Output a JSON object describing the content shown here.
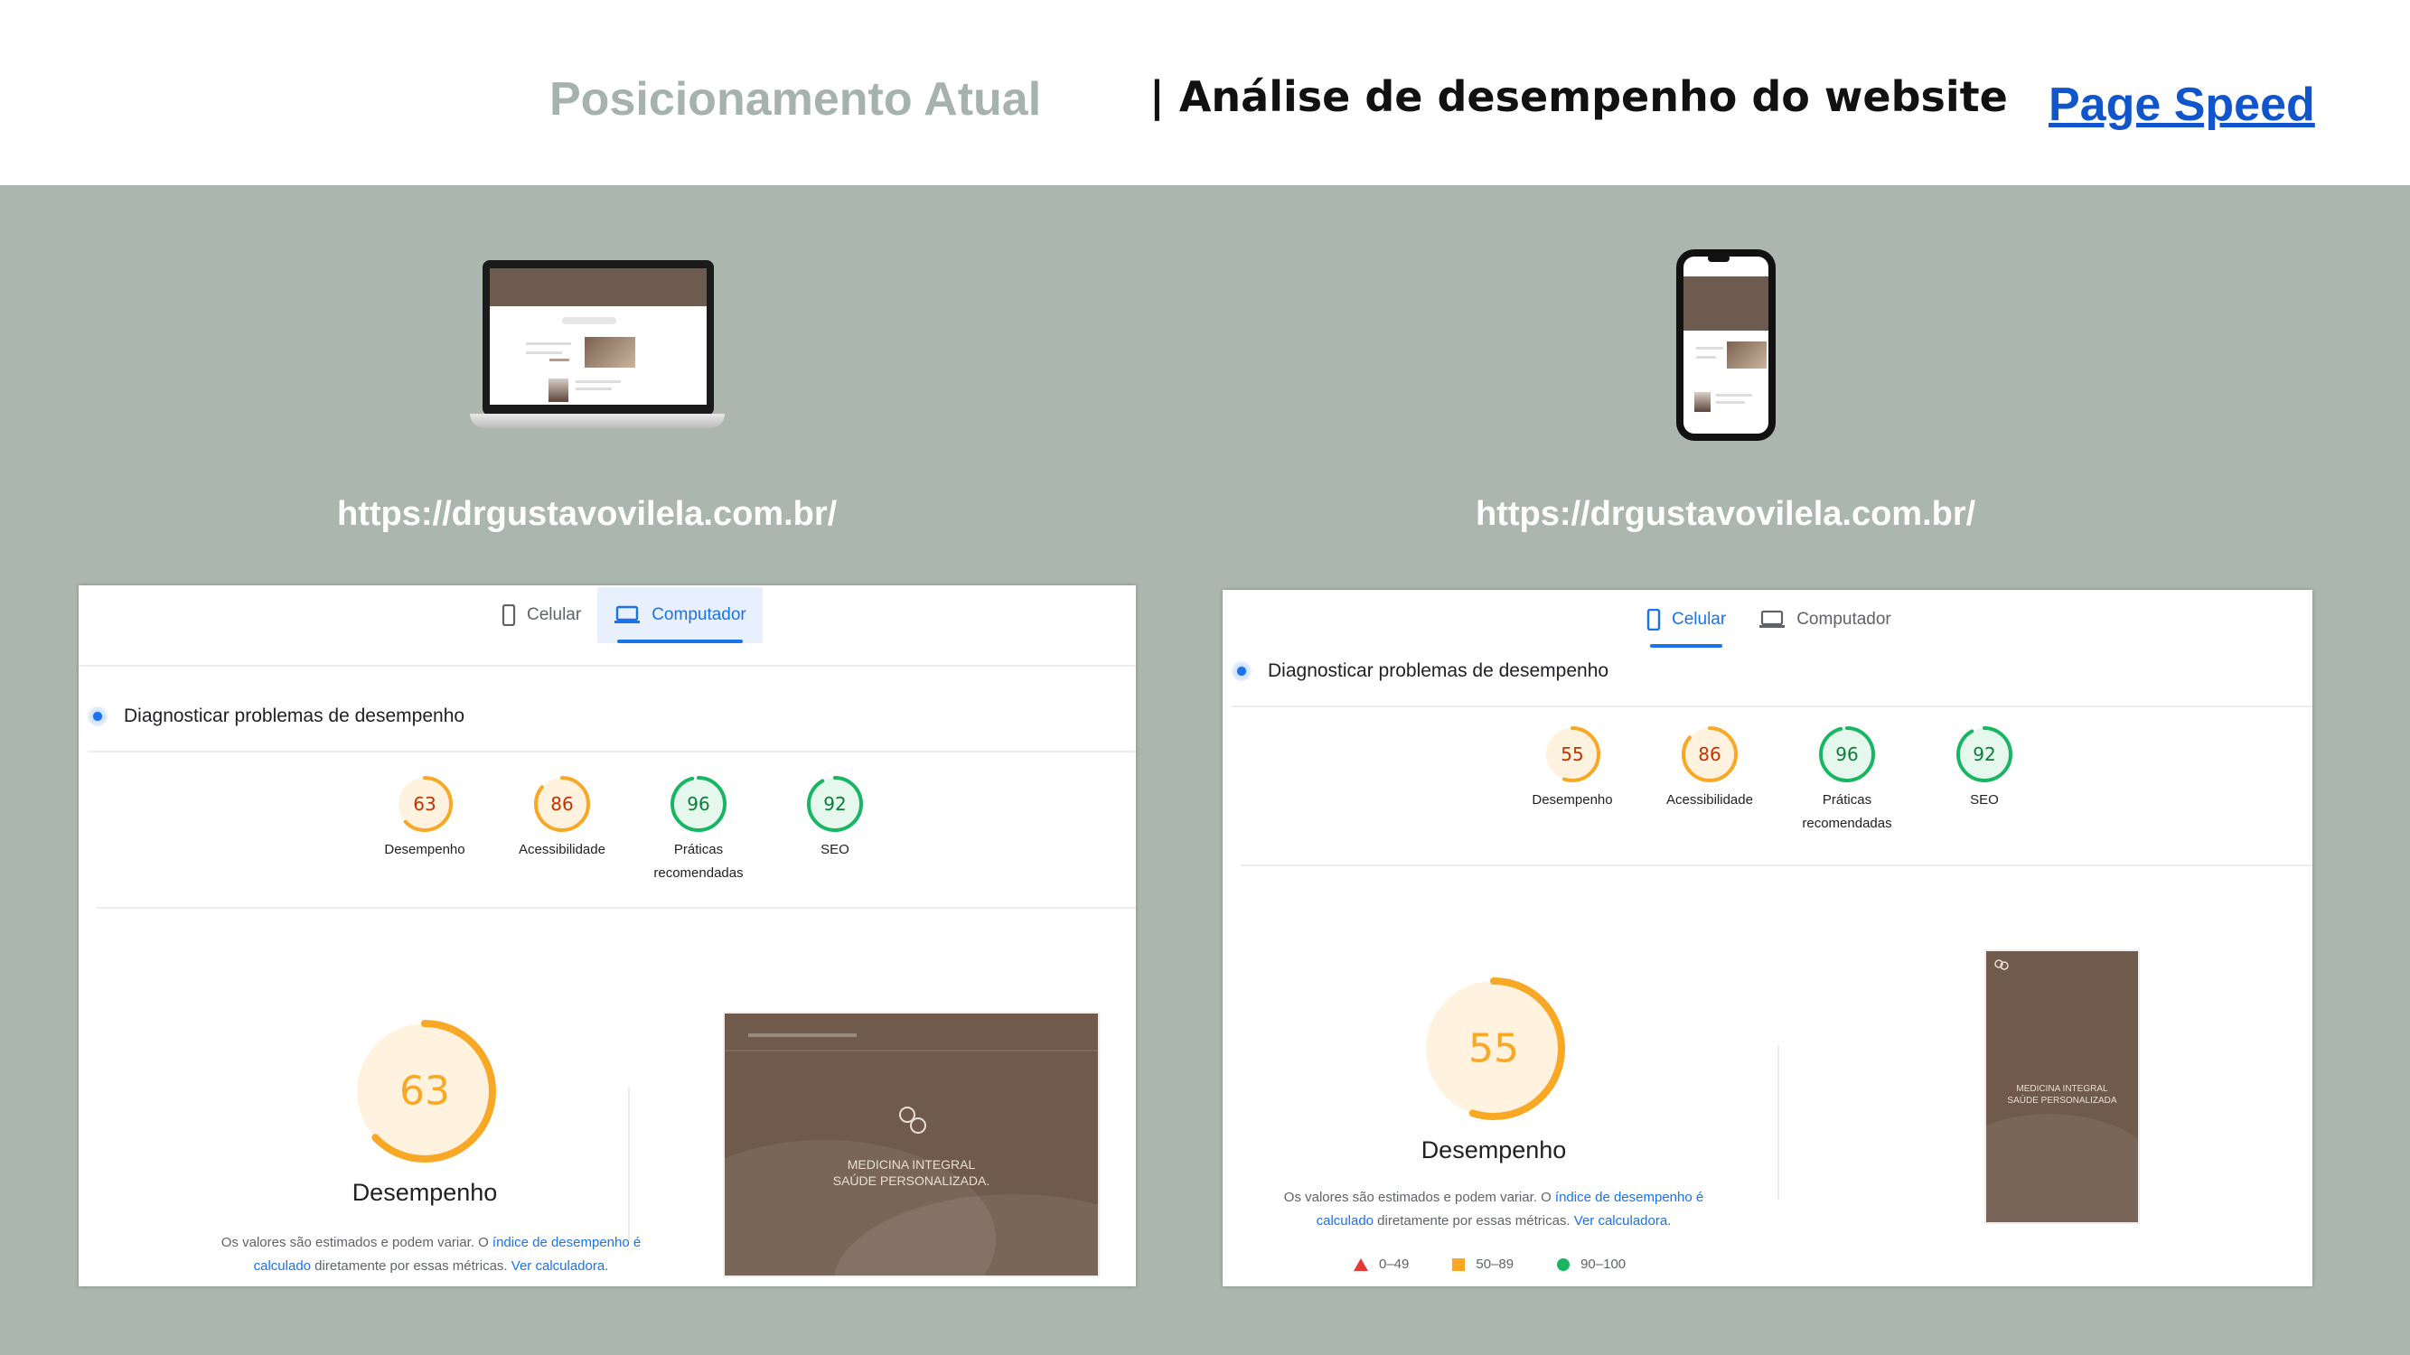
{
  "header": {
    "title_left": "Posicionamento Atual",
    "title_mid": "| Análise de desempenho do website",
    "link": "Page Speed"
  },
  "left": {
    "device": "laptop-mockup",
    "url": "https://drgustavovilela.com.br/",
    "tabs": [
      "Celular",
      "Computador"
    ],
    "active_tab": "Computador",
    "diag_title": "Diagnosticar problemas de desempenho",
    "scores": [
      {
        "value": "63",
        "label": "Desempenho",
        "status": "average"
      },
      {
        "value": "86",
        "label": "Acessibilidade",
        "status": "average"
      },
      {
        "value": "96",
        "label_line1": "Práticas",
        "label_line2": "recomendadas",
        "status": "good"
      },
      {
        "value": "92",
        "label": "SEO",
        "status": "good"
      }
    ],
    "big_score": "63",
    "big_label": "Desempenho",
    "note_1": "Os valores são estimados e podem variar. O ",
    "note_link_1": "índice de desempenho é",
    "note_link_1b": "calculado",
    "note_2": " diretamente por essas métricas. ",
    "note_link_2": "Ver calculadora.",
    "thumb_line1": "MEDICINA INTEGRAL",
    "thumb_line2": "SAÚDE PERSONALIZADA."
  },
  "right": {
    "device": "phone-mockup",
    "url": "https://drgustavovilela.com.br/",
    "tabs": [
      "Celular",
      "Computador"
    ],
    "active_tab": "Celular",
    "diag_title": "Diagnosticar problemas de desempenho",
    "scores": [
      {
        "value": "55",
        "label": "Desempenho",
        "status": "average"
      },
      {
        "value": "86",
        "label": "Acessibilidade",
        "status": "average"
      },
      {
        "value": "96",
        "label_line1": "Práticas",
        "label_line2": "recomendadas",
        "status": "good"
      },
      {
        "value": "92",
        "label": "SEO",
        "status": "good"
      }
    ],
    "big_score": "55",
    "big_label": "Desempenho",
    "note_1": "Os valores são estimados e podem variar. O ",
    "note_link_1": "índice de desempenho é",
    "note_link_1b": "calculado",
    "note_2": " diretamente por essas métricas. ",
    "note_link_2": "Ver calculadora.",
    "thumb_line1": "MEDICINA INTEGRAL",
    "thumb_line2": "SAÚDE PERSONALIZADA",
    "legend": [
      "0–49",
      "50–89",
      "90–100"
    ]
  },
  "colors": {
    "band": "#abb6ae",
    "average": "#f9a825",
    "average_text": "#c33300",
    "good": "#18b663",
    "good_text": "#0a7d3b",
    "link": "#1a73e8"
  }
}
